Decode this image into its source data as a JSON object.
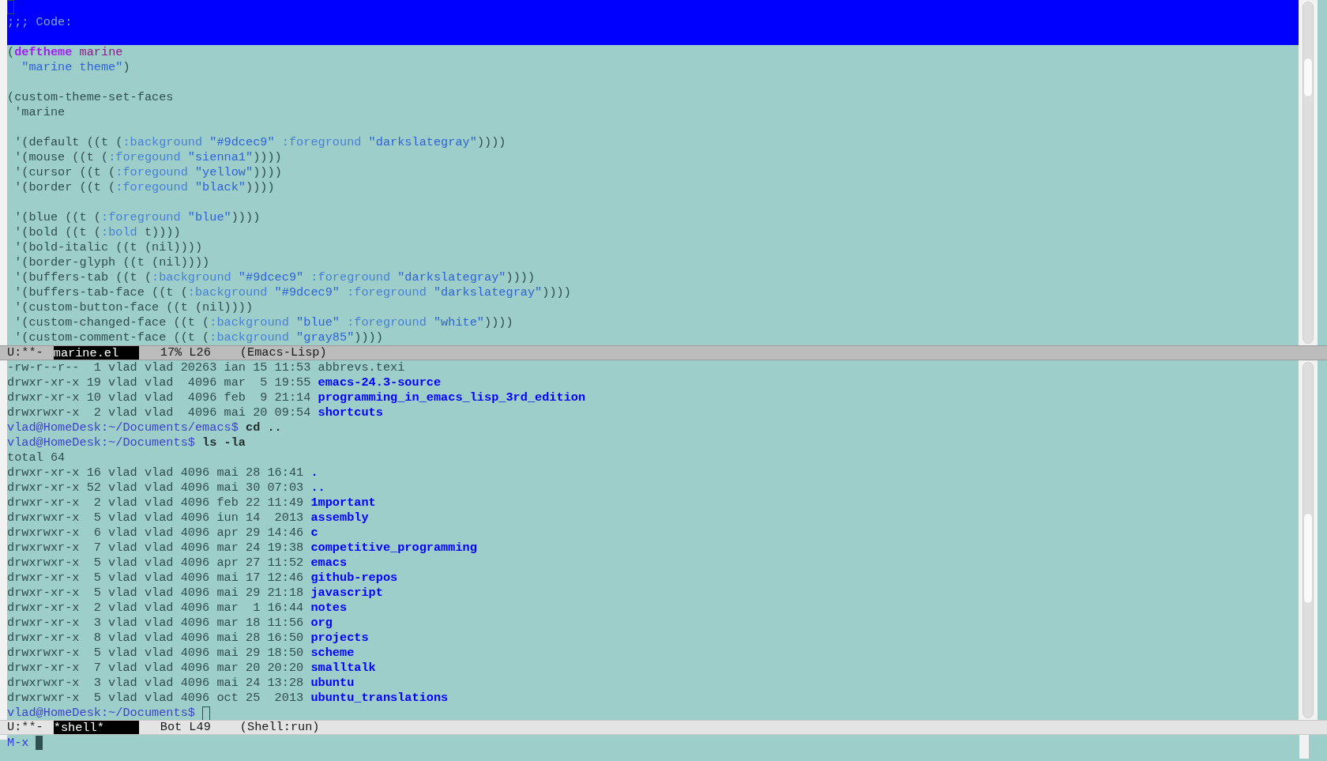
{
  "header": {
    "comment": ";;; Code:"
  },
  "code_blocks": [
    [
      [
        {
          "kind": "plain",
          "text": "("
        },
        {
          "kind": "builtin",
          "text": "deftheme"
        },
        {
          "kind": "name",
          "text": " marine"
        }
      ],
      [
        {
          "kind": "string",
          "text": "  \"marine theme\""
        },
        {
          "kind": "plain",
          "text": ")"
        }
      ]
    ],
    [
      [
        {
          "kind": "plain",
          "text": "(custom-theme-set-faces"
        }
      ],
      [
        {
          "kind": "plain",
          "text": " 'marine"
        }
      ]
    ],
    [
      [
        {
          "kind": "plain",
          "text": " '(default ((t ("
        },
        {
          "kind": "prop",
          "text": ":background"
        },
        {
          "kind": "string",
          "text": " \"#9dcec9\""
        },
        {
          "kind": "prop",
          "text": " :foreground"
        },
        {
          "kind": "string",
          "text": " \"darkslategray\""
        },
        {
          "kind": "plain",
          "text": "))))"
        }
      ],
      [
        {
          "kind": "plain",
          "text": " '(mouse ((t ("
        },
        {
          "kind": "prop",
          "text": ":foregound"
        },
        {
          "kind": "string",
          "text": " \"sienna1\""
        },
        {
          "kind": "plain",
          "text": "))))"
        }
      ],
      [
        {
          "kind": "plain",
          "text": " '(cursor ((t ("
        },
        {
          "kind": "prop",
          "text": ":foregound"
        },
        {
          "kind": "string",
          "text": " \"yellow\""
        },
        {
          "kind": "plain",
          "text": "))))"
        }
      ],
      [
        {
          "kind": "plain",
          "text": " '(border ((t ("
        },
        {
          "kind": "prop",
          "text": ":foregound"
        },
        {
          "kind": "string",
          "text": " \"black\""
        },
        {
          "kind": "plain",
          "text": "))))"
        }
      ]
    ],
    [
      [
        {
          "kind": "plain",
          "text": " '(blue ((t ("
        },
        {
          "kind": "prop",
          "text": ":foreground"
        },
        {
          "kind": "string",
          "text": " \"blue\""
        },
        {
          "kind": "plain",
          "text": "))))"
        }
      ],
      [
        {
          "kind": "plain",
          "text": " '(bold ((t ("
        },
        {
          "kind": "prop",
          "text": ":bold"
        },
        {
          "kind": "plain",
          "text": " t))))"
        }
      ],
      [
        {
          "kind": "plain",
          "text": " '(bold-italic ((t (nil))))"
        }
      ],
      [
        {
          "kind": "plain",
          "text": " '(border-glyph ((t (nil))))"
        }
      ],
      [
        {
          "kind": "plain",
          "text": " '(buffers-tab ((t ("
        },
        {
          "kind": "prop",
          "text": ":background"
        },
        {
          "kind": "string",
          "text": " \"#9dcec9\""
        },
        {
          "kind": "prop",
          "text": " :foreground"
        },
        {
          "kind": "string",
          "text": " \"darkslategray\""
        },
        {
          "kind": "plain",
          "text": "))))"
        }
      ],
      [
        {
          "kind": "plain",
          "text": " '(buffers-tab-face ((t ("
        },
        {
          "kind": "prop",
          "text": ":background"
        },
        {
          "kind": "string",
          "text": " \"#9dcec9\""
        },
        {
          "kind": "prop",
          "text": " :foreground"
        },
        {
          "kind": "string",
          "text": " \"darkslategray\""
        },
        {
          "kind": "plain",
          "text": "))))"
        }
      ],
      [
        {
          "kind": "plain",
          "text": " '(custom-button-face ((t (nil))))"
        }
      ],
      [
        {
          "kind": "plain",
          "text": " '(custom-changed-face ((t ("
        },
        {
          "kind": "prop",
          "text": ":background"
        },
        {
          "kind": "string",
          "text": " \"blue\""
        },
        {
          "kind": "prop",
          "text": " :foreground"
        },
        {
          "kind": "string",
          "text": " \"white\""
        },
        {
          "kind": "plain",
          "text": "))))"
        }
      ],
      [
        {
          "kind": "plain",
          "text": " '(custom-comment-face ((t ("
        },
        {
          "kind": "prop",
          "text": ":background"
        },
        {
          "kind": "string",
          "text": " \"gray85\""
        },
        {
          "kind": "plain",
          "text": "))))"
        }
      ]
    ]
  ],
  "mode_lines": [
    {
      "active": true,
      "status": "U:**-",
      "buffer": "marine.el",
      "position": "17% L26",
      "mode": "(Emacs-Lisp)"
    },
    {
      "active": false,
      "status": "U:**-",
      "buffer": "*shell*",
      "position": "Bot L49",
      "mode": "(Shell:run)"
    }
  ],
  "shell_lines": [
    {
      "kind": "file",
      "text": "-rw-r--r--  1 vlad vlad 20263 ian 15 11:53 ",
      "name": "abbrevs.texi"
    },
    {
      "kind": "dir",
      "text": "drwxr-xr-x 19 vlad vlad  4096 mar  5 19:55 ",
      "name": "emacs-24.3-source"
    },
    {
      "kind": "dir",
      "text": "drwxr-xr-x 10 vlad vlad  4096 feb  9 21:14 ",
      "name": "programming_in_emacs_lisp_3rd_edition"
    },
    {
      "kind": "dir",
      "text": "drwxrwxr-x  2 vlad vlad  4096 mai 20 09:54 ",
      "name": "shortcuts"
    },
    {
      "kind": "prompt",
      "text": "vlad@HomeDesk:~/Documents/emacs$ ",
      "name": "cd .."
    },
    {
      "kind": "prompt",
      "text": "vlad@HomeDesk:~/Documents$ ",
      "name": "ls -la"
    },
    {
      "kind": "file",
      "text": "total 64"
    },
    {
      "kind": "dir",
      "text": "drwxr-xr-x 16 vlad vlad 4096 mai 28 16:41 ",
      "name": "."
    },
    {
      "kind": "dir",
      "text": "drwxr-xr-x 52 vlad vlad 4096 mai 30 07:03 ",
      "name": ".."
    },
    {
      "kind": "dir",
      "text": "drwxr-xr-x  2 vlad vlad 4096 feb 22 11:49 ",
      "name": "1mportant"
    },
    {
      "kind": "dir",
      "text": "drwxrwxr-x  5 vlad vlad 4096 iun 14  2013 ",
      "name": "assembly"
    },
    {
      "kind": "dir",
      "text": "drwxrwxr-x  6 vlad vlad 4096 apr 29 14:46 ",
      "name": "c"
    },
    {
      "kind": "dir",
      "text": "drwxrwxr-x  7 vlad vlad 4096 mar 24 19:38 ",
      "name": "competitive_programming"
    },
    {
      "kind": "dir",
      "text": "drwxrwxr-x  5 vlad vlad 4096 apr 27 11:52 ",
      "name": "emacs"
    },
    {
      "kind": "dir",
      "text": "drwxr-xr-x  5 vlad vlad 4096 mai 17 12:46 ",
      "name": "github-repos"
    },
    {
      "kind": "dir",
      "text": "drwxr-xr-x  5 vlad vlad 4096 mai 29 21:18 ",
      "name": "javascript"
    },
    {
      "kind": "dir",
      "text": "drwxr-xr-x  2 vlad vlad 4096 mar  1 16:44 ",
      "name": "notes"
    },
    {
      "kind": "dir",
      "text": "drwxr-xr-x  3 vlad vlad 4096 mar 18 11:56 ",
      "name": "org"
    },
    {
      "kind": "dir",
      "text": "drwxr-xr-x  8 vlad vlad 4096 mai 28 16:50 ",
      "name": "projects"
    },
    {
      "kind": "dir",
      "text": "drwxrwxr-x  5 vlad vlad 4096 mai 29 18:50 ",
      "name": "scheme"
    },
    {
      "kind": "dir",
      "text": "drwxr-xr-x  7 vlad vlad 4096 mar 20 20:20 ",
      "name": "smalltalk"
    },
    {
      "kind": "dir",
      "text": "drwxrwxr-x  3 vlad vlad 4096 mai 24 13:28 ",
      "name": "ubuntu"
    },
    {
      "kind": "dir",
      "text": "drwxrwxr-x  5 vlad vlad 4096 oct 25  2013 ",
      "name": "ubuntu_translations"
    }
  ],
  "shell_prompt": "vlad@HomeDesk:~/Documents$",
  "minibuffer": {
    "prompt": "M-x"
  }
}
